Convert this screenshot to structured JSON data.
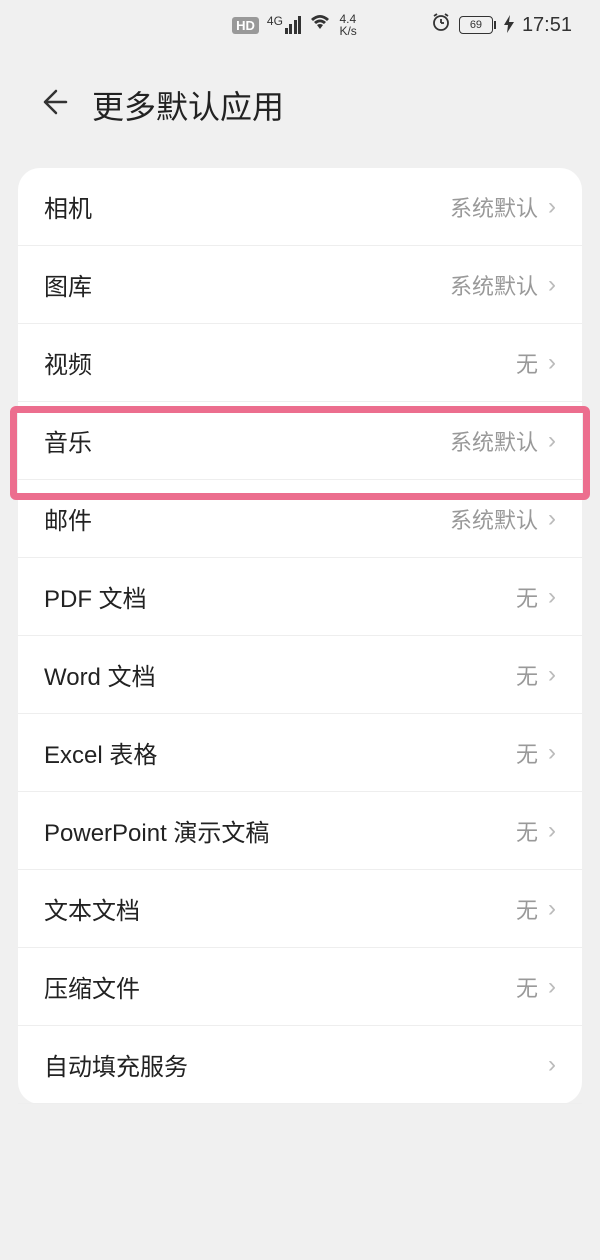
{
  "status": {
    "hd": "HD",
    "net": "4G",
    "speed_top": "4.4",
    "speed_bottom": "K/s",
    "battery": "69",
    "time": "17:51"
  },
  "header": {
    "title": "更多默认应用"
  },
  "rows": [
    {
      "label": "相机",
      "value": "系统默认"
    },
    {
      "label": "图库",
      "value": "系统默认"
    },
    {
      "label": "视频",
      "value": "无"
    },
    {
      "label": "音乐",
      "value": "系统默认"
    },
    {
      "label": "邮件",
      "value": "系统默认"
    },
    {
      "label": "PDF 文档",
      "value": "无"
    },
    {
      "label": "Word 文档",
      "value": "无"
    },
    {
      "label": "Excel 表格",
      "value": "无"
    },
    {
      "label": "PowerPoint 演示文稿",
      "value": "无"
    },
    {
      "label": "文本文档",
      "value": "无"
    },
    {
      "label": "压缩文件",
      "value": "无"
    },
    {
      "label": "自动填充服务",
      "value": ""
    }
  ]
}
